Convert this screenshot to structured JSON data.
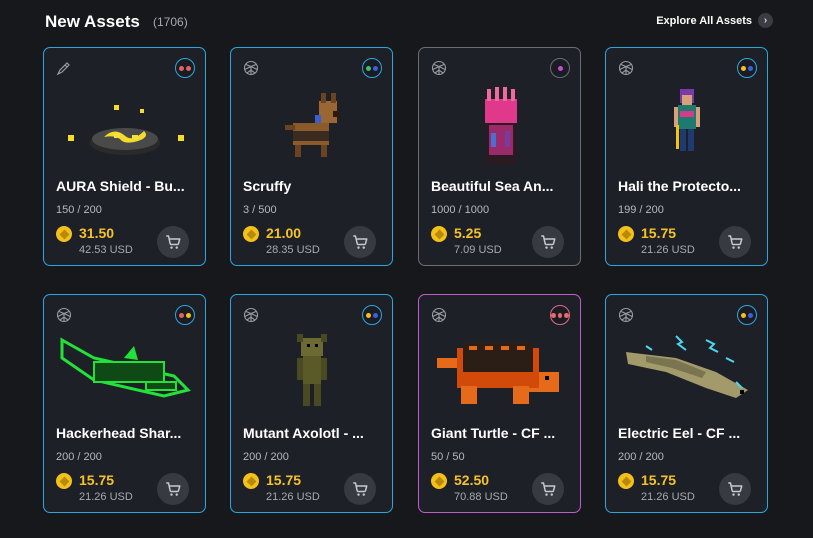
{
  "header": {
    "title": "New Assets",
    "count": "(1706)",
    "explore_label": "Explore All Assets"
  },
  "colors": {
    "accent_blue": "#2aa7df",
    "gray_border": "#6b6d73",
    "purple_pink_border": "#c35bd0",
    "price_gold": "#f5c326"
  },
  "cards": [
    {
      "name": "AURA Shield - Bu...",
      "supply": "150 / 200",
      "price": "31.50",
      "usd": "42.53 USD",
      "type_icon": "brush-icon",
      "border": "blue",
      "rarity_dots": [
        "#e06262",
        "#e06262"
      ]
    },
    {
      "name": "Scruffy",
      "supply": "3 / 500",
      "price": "21.00",
      "usd": "28.35 USD",
      "type_icon": "voxel-ball-icon",
      "border": "blue",
      "rarity_dots": [
        "#3fc06b",
        "#3a5fe0"
      ]
    },
    {
      "name": "Beautiful Sea An...",
      "supply": "1000 / 1000",
      "price": "5.25",
      "usd": "7.09 USD",
      "type_icon": "voxel-ball-icon",
      "border": "gray",
      "rarity_dots": [
        "#c34fd3"
      ]
    },
    {
      "name": "Hali the Protecto...",
      "supply": "199 / 200",
      "price": "15.75",
      "usd": "21.26 USD",
      "type_icon": "voxel-ball-icon",
      "border": "blue",
      "rarity_dots": [
        "#f4c01b",
        "#3a5fe0"
      ]
    },
    {
      "name": "Hackerhead Shar...",
      "supply": "200 / 200",
      "price": "15.75",
      "usd": "21.26 USD",
      "type_icon": "voxel-ball-icon",
      "border": "blue",
      "rarity_dots": [
        "#e06262",
        "#f4c01b"
      ]
    },
    {
      "name": "Mutant Axolotl - ...",
      "supply": "200 / 200",
      "price": "15.75",
      "usd": "21.26 USD",
      "type_icon": "voxel-ball-icon",
      "border": "blue",
      "rarity_dots": [
        "#f4c01b",
        "#3a5fe0"
      ]
    },
    {
      "name": "Giant Turtle - CF ...",
      "supply": "50 / 50",
      "price": "52.50",
      "usd": "70.88 USD",
      "type_icon": "voxel-ball-icon",
      "border": "gradient",
      "rarity_dots": [
        "#e86a6a",
        "#e86a6a",
        "#e86a6a"
      ]
    },
    {
      "name": "Electric Eel - CF ...",
      "supply": "200 / 200",
      "price": "15.75",
      "usd": "21.26 USD",
      "type_icon": "voxel-ball-icon",
      "border": "blue",
      "rarity_dots": [
        "#f4c01b",
        "#3a5fe0"
      ]
    }
  ]
}
